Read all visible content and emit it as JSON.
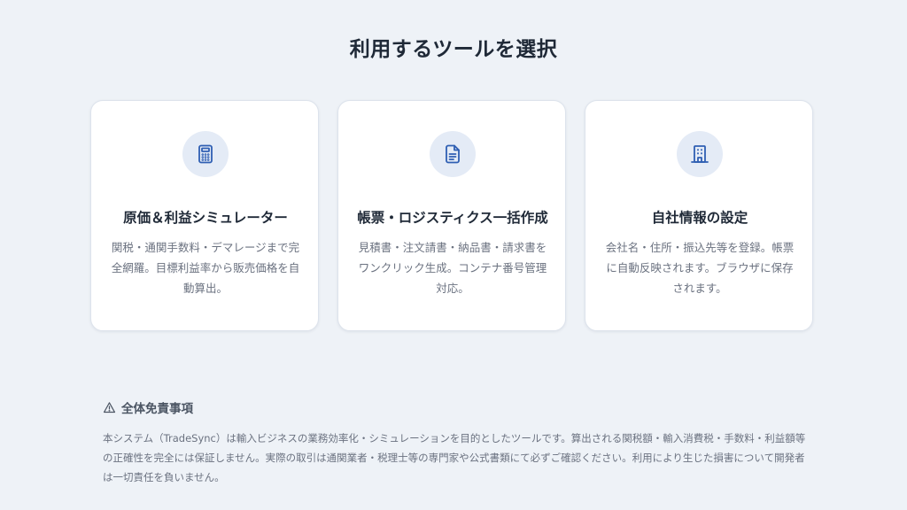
{
  "header": {
    "title": "利用するツールを選択"
  },
  "cards": [
    {
      "icon": "calculator-icon",
      "title": "原価＆利益シミュレーター",
      "description": "関税・通関手数料・デマレージまで完全網羅。目標利益率から販売価格を自動算出。"
    },
    {
      "icon": "document-icon",
      "title": "帳票・ロジスティクス一括作成",
      "description": "見積書・注文請書・納品書・請求書をワンクリック生成。コンテナ番号管理対応。"
    },
    {
      "icon": "building-icon",
      "title": "自社情報の設定",
      "description": "会社名・住所・振込先等を登録。帳票に自動反映されます。ブラウザに保存されます。"
    }
  ],
  "disclaimer": {
    "icon": "warning-icon",
    "title": "全体免責事項",
    "body": "本システム（TradeSync）は輸入ビジネスの業務効率化・シミュレーションを目的としたツールです。算出される関税額・輸入消費税・手数料・利益額等の正確性を完全には保証しません。実際の取引は通関業者・税理士等の専門家や公式書類にて必ずご確認ください。利用により生じた損害について開発者は一切責任を負いません。"
  },
  "colors": {
    "background": "#eef2f7",
    "card": "#ffffff",
    "icon_accent": "#2f5fb3",
    "icon_circle": "#e4ebf6"
  }
}
